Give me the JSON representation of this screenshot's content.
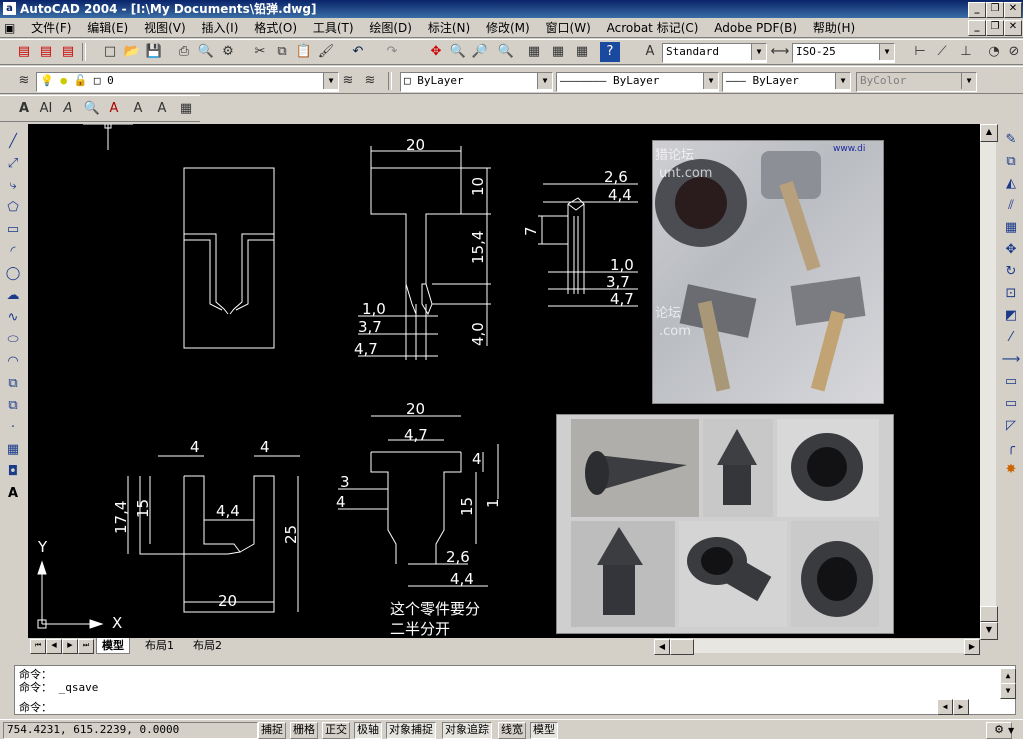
{
  "window": {
    "title": "AutoCAD 2004 - [I:\\My Documents\\铅弹.dwg]",
    "app_icon": "a",
    "controls": [
      "_",
      "❐",
      "✕"
    ]
  },
  "menu": [
    "文件(F)",
    "编辑(E)",
    "视图(V)",
    "插入(I)",
    "格式(O)",
    "工具(T)",
    "绘图(D)",
    "标注(N)",
    "修改(M)",
    "窗口(W)",
    "Acrobat 标记(C)",
    "Adobe PDF(B)",
    "帮助(H)"
  ],
  "toolbar": {
    "text_style": "Standard",
    "dim_style": "ISO-25",
    "layer": "0",
    "color": "ByLayer",
    "linetype": "ByLayer",
    "lineweight": "ByLayer",
    "plot_style": "ByColor"
  },
  "drawing": {
    "dims_top_left_part": [
      "20",
      "10",
      "15,4",
      "4,0",
      "1,0",
      "3,7",
      "4,7"
    ],
    "dims_detail": [
      "2,6",
      "4,4",
      "7",
      "1,0",
      "3,7",
      "4,7"
    ],
    "dims_bottom_left": [
      "4",
      "4",
      "17,4",
      "15",
      "4,4",
      "25",
      "20"
    ],
    "dims_bottom_mid": [
      "20",
      "4,7",
      "4",
      "3",
      "4",
      "15",
      "1",
      "2,6",
      "4,4"
    ],
    "note_line1": "这个零件要分",
    "note_line2": "二半分开",
    "ucs_y": "Y",
    "ucs_x": "X",
    "photo1_watermark1": "猎论坛",
    "photo1_watermark2": "unt.com",
    "photo1_watermark3": "论坛",
    "photo1_watermark4": ".com",
    "photo1_corner": "www.di"
  },
  "tabs": [
    "模型",
    "布局1",
    "布局2"
  ],
  "command": {
    "line1": "命令：",
    "line2": "命令： _qsave",
    "line3": "命令："
  },
  "status": {
    "coords": "754.4231, 615.2239, 0.0000",
    "buttons": [
      "捕捉",
      "栅格",
      "正交",
      "极轴",
      "对象捕捉",
      "对象追踪",
      "线宽",
      "模型"
    ]
  },
  "colors": {
    "titlebar": "#0a246a",
    "canvas": "#000000",
    "linework": "#ffffff",
    "ui_face": "#d4d0c8"
  }
}
